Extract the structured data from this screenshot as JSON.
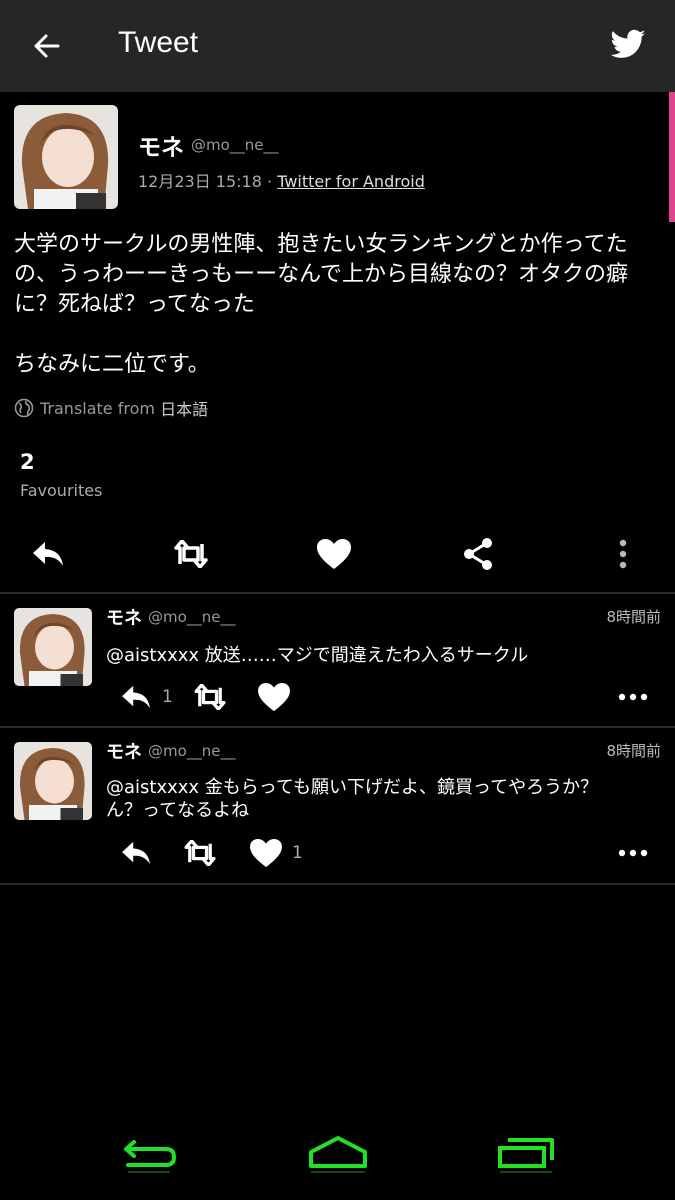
{
  "header": {
    "title": "Tweet"
  },
  "tweet": {
    "name": "モネ",
    "handle": "@mo__ne__",
    "date": "12月23日 15:18",
    "separator": " · ",
    "via": "Twitter for Android",
    "text_p1": "大学のサークルの男性陣、抱きたい女ランキングとか作ってたの、うっわーーきっもーーなんで上から目線なの？オタクの癖に？死ねば？ってなった",
    "text_p2": "ちなみに二位です。",
    "translate_prefix": "Translate from ",
    "translate_lang": "日本語",
    "favourites_count": "2",
    "favourites_label": "Favourites"
  },
  "replies": [
    {
      "name": "モネ",
      "handle": "@mo__ne__",
      "time": "8時間前",
      "text": "@aistxxxx 放送……マジで間違えたわ入るサークル",
      "reply_count": "1",
      "like_count": ""
    },
    {
      "name": "モネ",
      "handle": "@mo__ne__",
      "time": "8時間前",
      "text": "@aistxxxx 金もらっても願い下げだよ、鏡買ってやろうか？ん？ってなるよね",
      "reply_count": "",
      "like_count": "1"
    }
  ],
  "colors": {
    "topbar": "#262626",
    "accent_scroll": "#e0448f",
    "nav_green": "#22e022"
  },
  "icons": {
    "back": "arrow-left-icon",
    "bird": "twitter-bird-icon",
    "reply": "reply-icon",
    "retweet": "retweet-icon",
    "like": "heart-icon",
    "share": "share-icon",
    "more": "more-vertical-icon",
    "more_h": "more-horizontal-icon",
    "nav_back": "nav-back-icon",
    "nav_home": "nav-home-icon",
    "nav_recent": "nav-recent-icon"
  }
}
